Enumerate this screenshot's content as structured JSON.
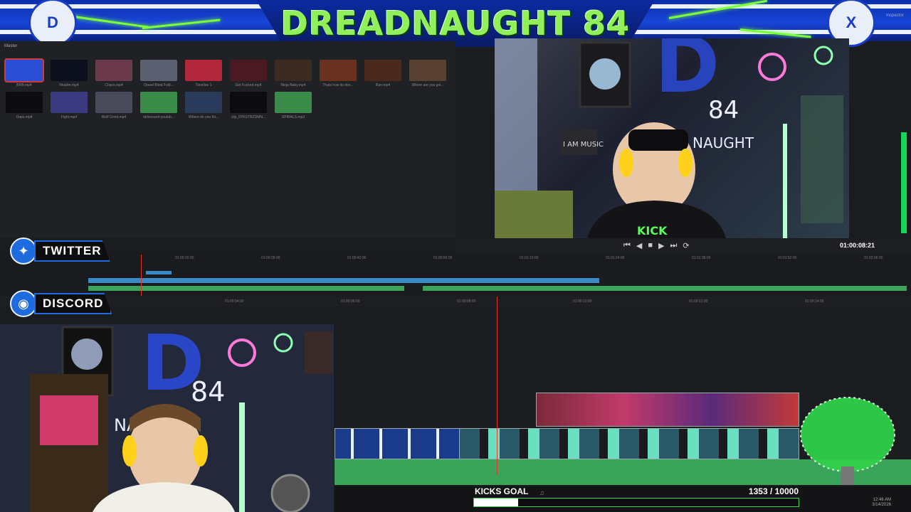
{
  "banner": {
    "title": "DREADNAUGHT 84",
    "left_logo": "D",
    "right_logo": "X"
  },
  "media_pool": {
    "label": "Master",
    "clips_row1": [
      {
        "name": "BRB.mp4",
        "color": "#2a4fd6",
        "selected": true
      },
      {
        "name": "Header.mp4",
        "color": "#0c0f1c",
        "selected": false
      },
      {
        "name": "Chaos.mp4",
        "color": "#6a3a4a",
        "selected": false
      },
      {
        "name": "Dread Blind Fold...",
        "color": "#5a6070",
        "selected": false
      },
      {
        "name": "Timeline 1",
        "color": "#b0283a",
        "selected": false
      },
      {
        "name": "Get Fucked.mp4",
        "color": "#4a1a22",
        "selected": false
      },
      {
        "name": "Ninja Baby.mp4",
        "color": "#3a2a20",
        "selected": false
      },
      {
        "name": "Thats how its don...",
        "color": "#6a3020",
        "selected": false
      },
      {
        "name": "Run.mp4",
        "color": "#4a2a1c",
        "selected": false
      },
      {
        "name": "Where are you goi...",
        "color": "#5a4030",
        "selected": false
      }
    ],
    "clips_row2": [
      {
        "name": "Oops.mp4",
        "color": "#0c0c10"
      },
      {
        "name": "Fight.mp4",
        "color": "#3a3a80"
      },
      {
        "name": "Wolf Grind.mp4",
        "color": "#4a4a5a"
      },
      {
        "name": "delosound-youtub...",
        "color": "#3a8a4a"
      },
      {
        "name": "Where do you thi...",
        "color": "#2a3a5a"
      },
      {
        "name": "clip_0YKSTRZDMN...",
        "color": "#0c0c10"
      },
      {
        "name": "SPIRALS.mp3",
        "color": "#3a8a4a"
      }
    ]
  },
  "viewer": {
    "timecode": "01:00:08:21",
    "inspector": "Inspector"
  },
  "mini_timeline": {
    "ticks": [
      "01:00:16:00",
      "01:00:28:00",
      "01:00:42:00",
      "01:00:56:00",
      "01:01:10:00",
      "01:01:24:00",
      "01:01:38:00",
      "01:01:52:00",
      "01:02:06:00"
    ]
  },
  "main_timeline": {
    "ticks": [
      "01:00:04:00",
      "01:00:06:00",
      "01:00:08:00",
      "01:00:10:00",
      "01:00:12:00",
      "01:00:14:00"
    ]
  },
  "socials": {
    "twitter": "TWITTER",
    "discord": "DISCORD"
  },
  "goal": {
    "label": "KICKS GOAL",
    "count": "1353  / 10000",
    "progress": 0.1353
  },
  "clock": {
    "time": "12:46 AM",
    "date": "3/14/2026"
  },
  "colors": {
    "accent_blue": "#1a3dc8",
    "accent_green": "#8ff05a",
    "playhead_red": "#e23a2a",
    "track_green": "#3aa55a",
    "track_blue": "#3a8ac8"
  }
}
